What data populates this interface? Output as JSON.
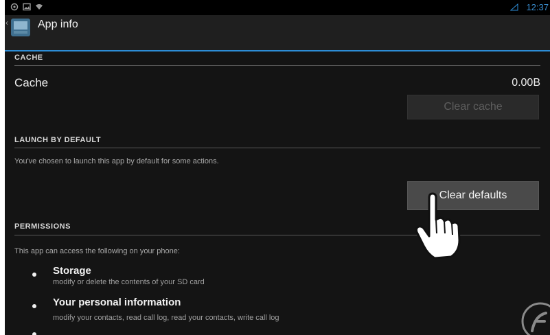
{
  "header": {
    "title": "App info",
    "time": "12:37",
    "back_glyph": "‹"
  },
  "cache_section": {
    "heading": "CACHE",
    "row_label": "Cache",
    "row_value": "0.00B",
    "button_label": "Clear cache"
  },
  "launch_section": {
    "heading": "LAUNCH BY DEFAULT",
    "description": "You've chosen to launch this app by default for some actions.",
    "button_label": "Clear defaults"
  },
  "permissions_section": {
    "heading": "PERMISSIONS",
    "intro": "This app can access the following on your phone:",
    "items": [
      {
        "title": "Storage",
        "desc": "modify or delete the contents of your SD card"
      },
      {
        "title": "Your personal information",
        "desc": "modify your contacts, read call log, read your contacts, write call log"
      }
    ]
  },
  "icons": {
    "status_left": [
      "location-icon",
      "image-notification-icon",
      "wifi-icon"
    ],
    "status_right": [
      "battery-icon"
    ],
    "overlay": [
      "hand-cursor-icon"
    ]
  },
  "colors": {
    "accent": "#2d8dd6",
    "background": "#141414"
  }
}
